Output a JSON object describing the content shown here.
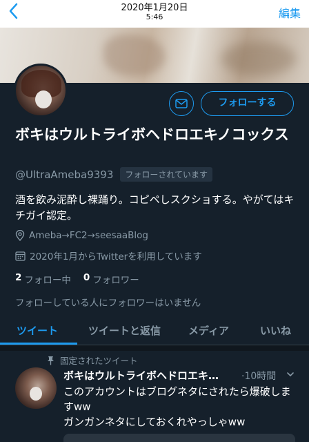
{
  "status_bar": {
    "date": "2020年1月20日",
    "time": "5:46"
  },
  "nav": {
    "back_icon": "chevron-left-icon",
    "edit_label": "編集"
  },
  "profile": {
    "name": "ボキはウルトライボヘドロエキノコックス",
    "handle": "@UltraAmeba9393",
    "follows_you_badge": "フォローされています",
    "bio": "酒を飲み泥酔し裸踊り。コピペしスクショする。やがてはキチガイ認定。",
    "location": "Ameba→FC2→seesaaBlog",
    "joined": "2020年1月からTwitterを利用しています",
    "following_count": "2",
    "following_label": "フォロー中",
    "followers_count": "0",
    "followers_label": "フォロワー",
    "mutual_note": "フォローしている人にフォロワーはいません"
  },
  "actions": {
    "follow_label": "フォローする",
    "message_icon": "mail-icon"
  },
  "tabs": [
    {
      "label": "ツイート",
      "active": true
    },
    {
      "label": "ツイートと返信",
      "active": false
    },
    {
      "label": "メディア",
      "active": false
    },
    {
      "label": "いいね",
      "active": false
    }
  ],
  "pinned_tweet": {
    "pinned_label": "固定されたツイート",
    "author": "ボキはウルトライボヘドロエキ…",
    "time": "·10時間",
    "text": "このアカウントはブログネタにされたら爆破しますww\nガンガンネタにしておくれやっしゃww"
  },
  "colors": {
    "accent": "#1d9bf0",
    "background": "#15202b",
    "muted": "#8899a6"
  }
}
